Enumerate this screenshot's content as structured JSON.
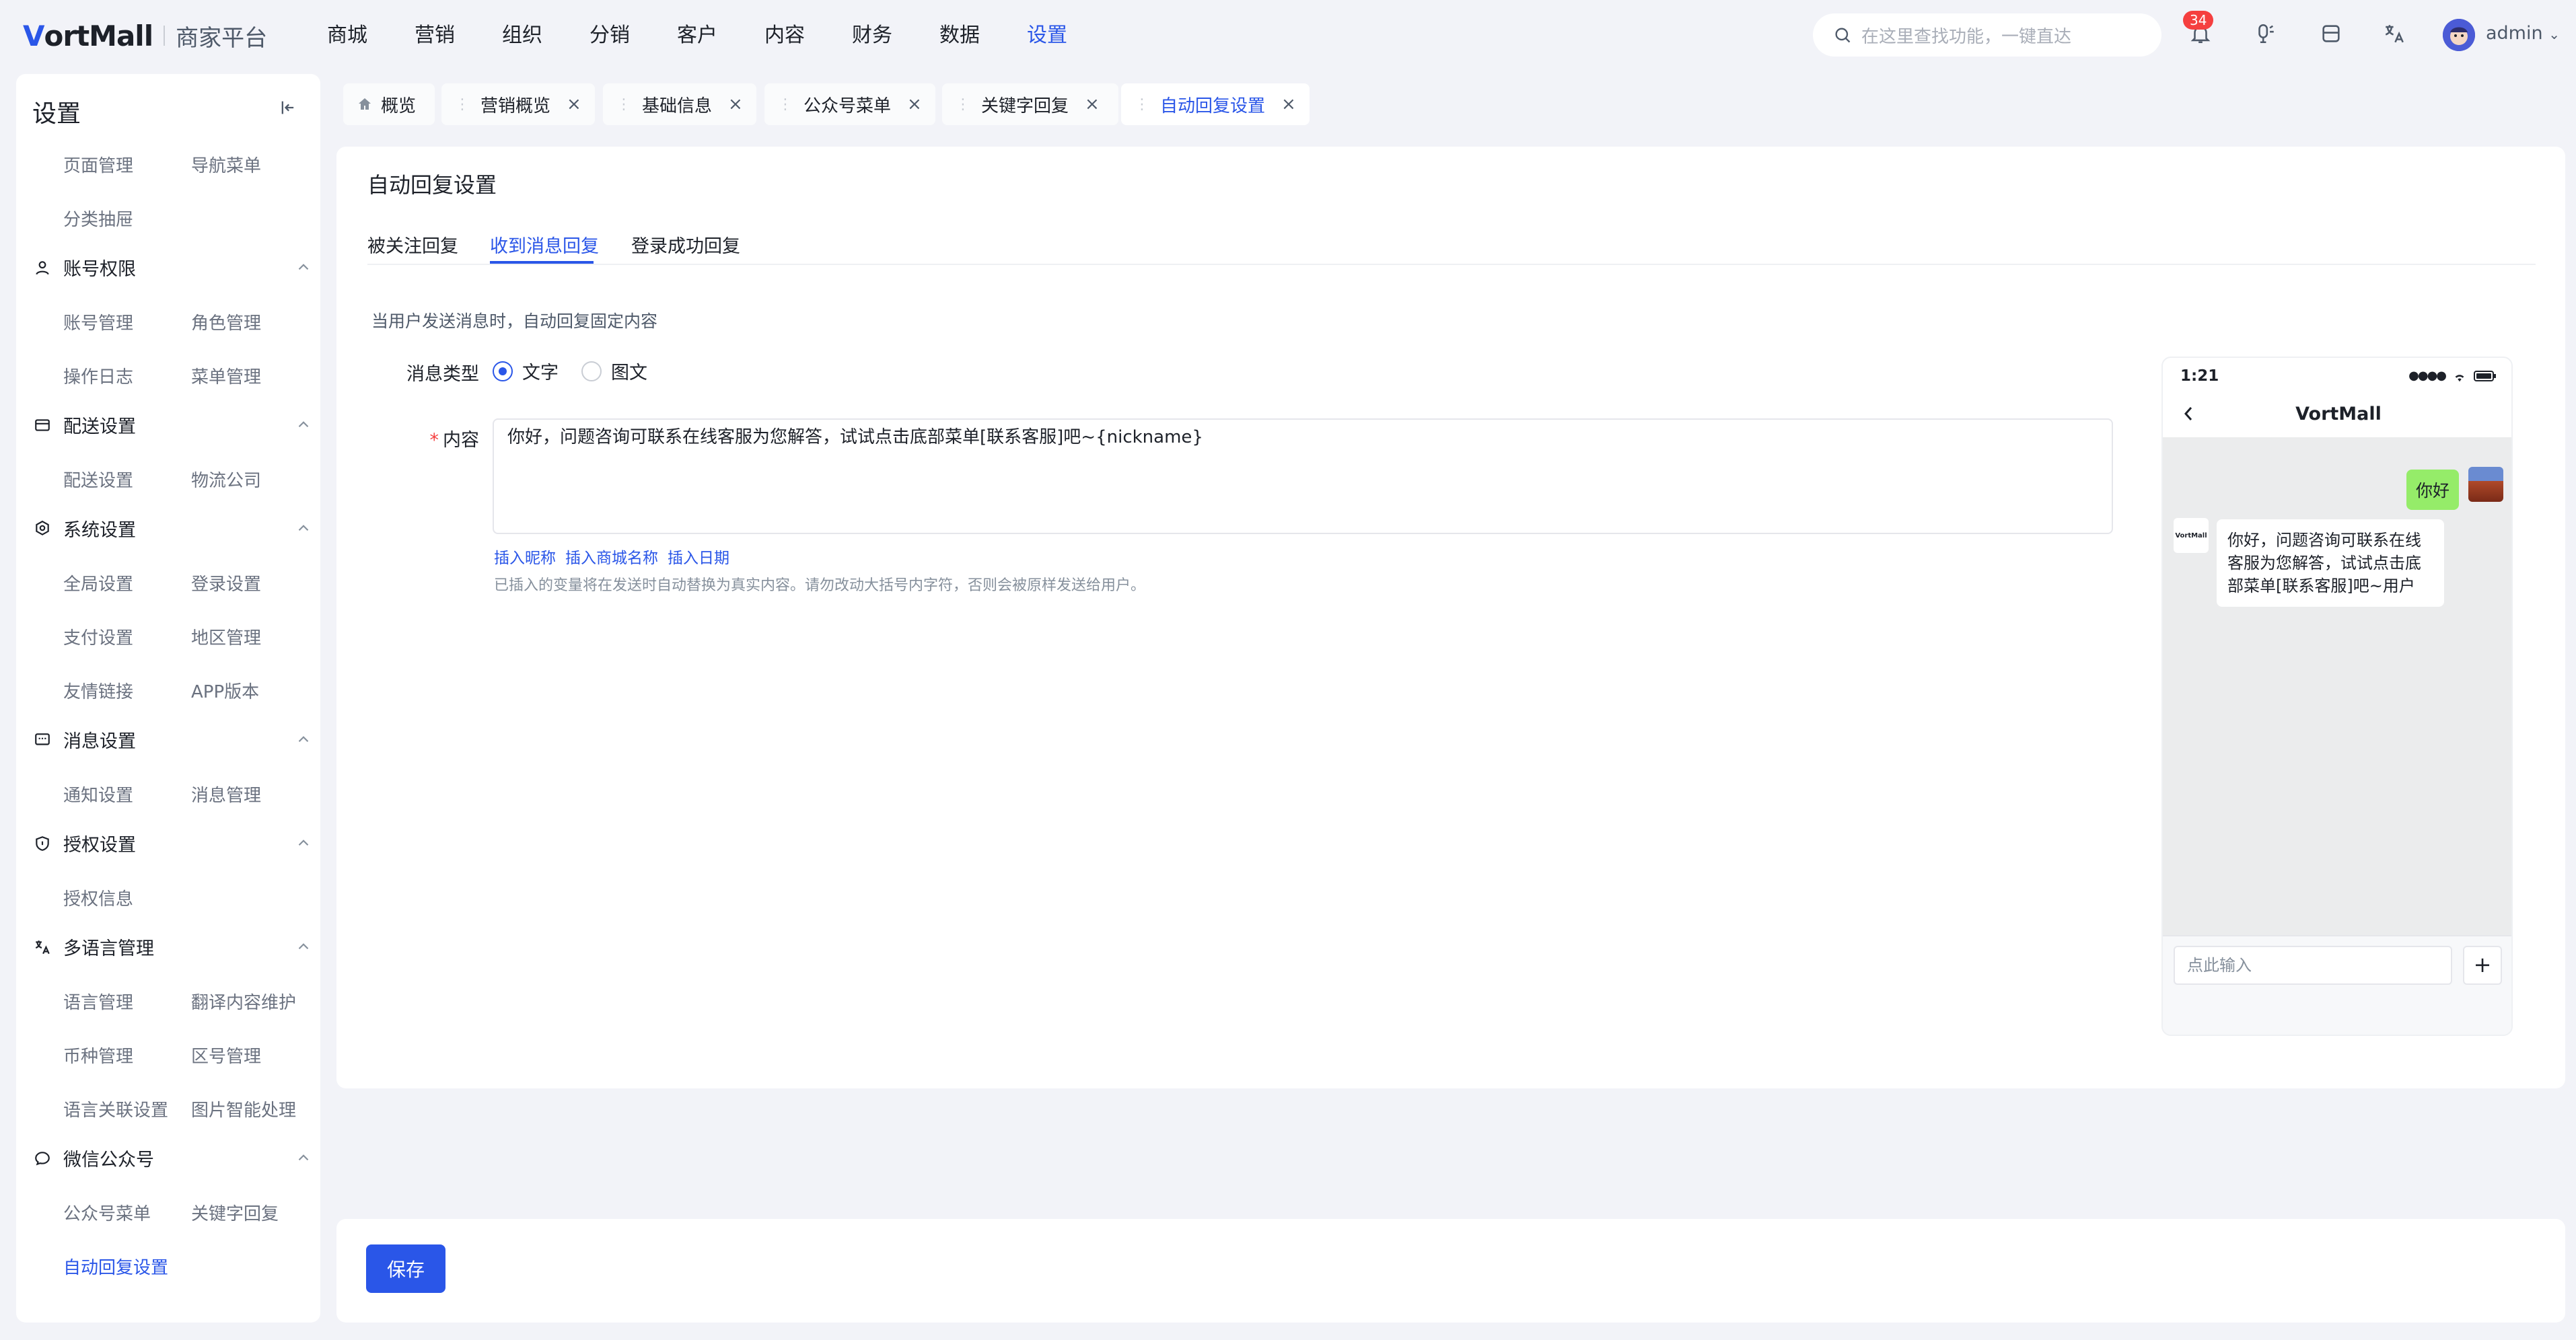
{
  "brand": {
    "logo": "VortMall",
    "logo_accent": "V",
    "logo_rest": "ortMall",
    "subtitle": "商家平台"
  },
  "nav": [
    {
      "label": "商城"
    },
    {
      "label": "营销"
    },
    {
      "label": "组织"
    },
    {
      "label": "分销"
    },
    {
      "label": "客户"
    },
    {
      "label": "内容"
    },
    {
      "label": "财务"
    },
    {
      "label": "数据"
    },
    {
      "label": "设置",
      "active": true
    }
  ],
  "search": {
    "placeholder": "在这里查找功能，一键直达"
  },
  "notifications": {
    "count": "34"
  },
  "user": {
    "name": "admin"
  },
  "sidebar": {
    "title": "设置",
    "items_top": [
      "页面管理",
      "导航菜单",
      "分类抽屉"
    ],
    "groups": [
      {
        "title": "账号权限",
        "icon": "user-icon",
        "items": [
          "账号管理",
          "角色管理",
          "操作日志",
          "菜单管理"
        ]
      },
      {
        "title": "配送设置",
        "icon": "delivery-icon",
        "items": [
          "配送设置",
          "物流公司"
        ]
      },
      {
        "title": "系统设置",
        "icon": "system-icon",
        "items": [
          "全局设置",
          "登录设置",
          "支付设置",
          "地区管理",
          "友情链接",
          "APP版本"
        ]
      },
      {
        "title": "消息设置",
        "icon": "message-icon",
        "items": [
          "通知设置",
          "消息管理"
        ]
      },
      {
        "title": "授权设置",
        "icon": "shield-icon",
        "items": [
          "授权信息"
        ]
      },
      {
        "title": "多语言管理",
        "icon": "translate-icon",
        "items": [
          "语言管理",
          "翻译内容维护",
          "币种管理",
          "区号管理",
          "语言关联设置",
          "图片智能处理"
        ]
      },
      {
        "title": "微信公众号",
        "icon": "wechat-icon",
        "items": [
          "公众号菜单",
          "关键字回复",
          "自动回复设置"
        ]
      }
    ]
  },
  "tabs": [
    {
      "label": "概览"
    },
    {
      "label": "营销概览"
    },
    {
      "label": "基础信息"
    },
    {
      "label": "公众号菜单"
    },
    {
      "label": "关键字回复"
    },
    {
      "label": "自动回复设置",
      "active": true
    }
  ],
  "page": {
    "title": "自动回复设置",
    "subtabs": [
      "被关注回复",
      "收到消息回复",
      "登录成功回复"
    ],
    "active_subtab": "收到消息回复",
    "description": "当用户发送消息时，自动回复固定内容",
    "message_type_label": "消息类型",
    "message_types": [
      "文字",
      "图文"
    ],
    "selected_type": "文字",
    "content_label": "内容",
    "content_required_mark": "*",
    "content_value": "你好，问题咨询可联系在线客服为您解答，试试点击底部菜单[联系客服]吧~{nickname}",
    "insert_links": [
      "插入昵称",
      "插入商城名称",
      "插入日期"
    ],
    "hint": "已插入的变量将在发送时自动替换为真实内容。请勿改动大括号内字符，否则会被原样发送给用户。"
  },
  "preview": {
    "time": "1:21",
    "title": "VortMall",
    "user_message": "你好",
    "bot_avatar_text": "VortMall",
    "bot_reply": "你好，问题咨询可联系在线客服为您解答，试试点击底部菜单[联系客服]吧~用户",
    "input_placeholder": "点此输入",
    "plus": "+"
  },
  "footer": {
    "save_label": "保存"
  },
  "colors": {
    "accent": "#2a56e8",
    "bubble_green": "#95ec69",
    "badge": "#f53f3f"
  }
}
